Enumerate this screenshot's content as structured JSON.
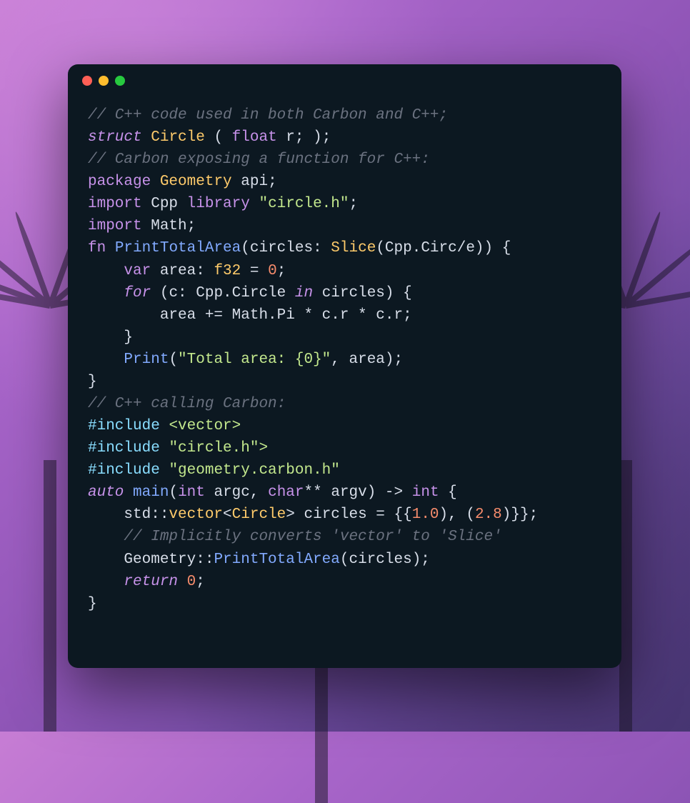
{
  "window": {
    "traffic_lights": [
      "red",
      "yellow",
      "green"
    ]
  },
  "code": {
    "lines": [
      {
        "t": "comment",
        "text": "// C++ code used in both Carbon and C++;"
      },
      {
        "t": "struct",
        "parts": [
          "struct",
          " ",
          "Circle",
          " ( ",
          "float",
          " r; );"
        ]
      },
      {
        "t": "comment",
        "text": "// Carbon exposing a function for C++:"
      },
      {
        "t": "pkg",
        "parts": [
          "package",
          " ",
          "Geometry",
          " api;"
        ]
      },
      {
        "t": "import",
        "parts": [
          "import",
          " Cpp ",
          "library",
          " ",
          "\"circle.h\"",
          ";"
        ]
      },
      {
        "t": "import2",
        "parts": [
          "import",
          " Math;"
        ]
      },
      {
        "t": "fn",
        "parts": [
          "fn",
          " ",
          "PrintTotalArea",
          "(circles: ",
          "Slice",
          "(Cpp.Circ/e)) {"
        ]
      },
      {
        "t": "var",
        "parts": [
          "    ",
          "var",
          " area: ",
          "f32",
          " = ",
          "0",
          ";"
        ]
      },
      {
        "t": "for",
        "parts": [
          "    ",
          "for",
          " (c: Cpp.Circle ",
          "in",
          " circles) {"
        ]
      },
      {
        "t": "calc",
        "parts": [
          "        area += Math.Pi * c.r * c.r;"
        ]
      },
      {
        "t": "close",
        "parts": [
          "    }"
        ]
      },
      {
        "t": "print",
        "parts": [
          "    ",
          "Print",
          "(",
          "\"Total area: {0}\"",
          ", area);"
        ]
      },
      {
        "t": "close2",
        "parts": [
          "}"
        ]
      },
      {
        "t": "comment",
        "text": "// C++ calling Carbon:"
      },
      {
        "t": "inc1",
        "parts": [
          "#include",
          " ",
          "<vector>"
        ]
      },
      {
        "t": "inc2",
        "parts": [
          "#include",
          " ",
          "\"circle.h\">"
        ]
      },
      {
        "t": "inc3",
        "parts": [
          "#include",
          " ",
          "\"geometry.carbon.h\""
        ]
      },
      {
        "t": "main",
        "parts": [
          "auto",
          " ",
          "main",
          "(",
          "int",
          " argc, ",
          "char",
          "** argv) -> ",
          "int",
          " {"
        ]
      },
      {
        "t": "vec",
        "parts": [
          "    std::",
          "vector",
          "<",
          "Circle",
          "> circles = {{",
          "1.0",
          "), (",
          "2.8",
          ")}};"
        ]
      },
      {
        "t": "comment",
        "text": "    // Implicitly converts 'vector' to 'Slice'"
      },
      {
        "t": "call",
        "parts": [
          "    Geometry::",
          "PrintTotalArea",
          "(circles);"
        ]
      },
      {
        "t": "ret",
        "parts": [
          "    ",
          "return",
          " ",
          "0",
          ";"
        ]
      },
      {
        "t": "close3",
        "parts": [
          "}"
        ]
      }
    ]
  }
}
